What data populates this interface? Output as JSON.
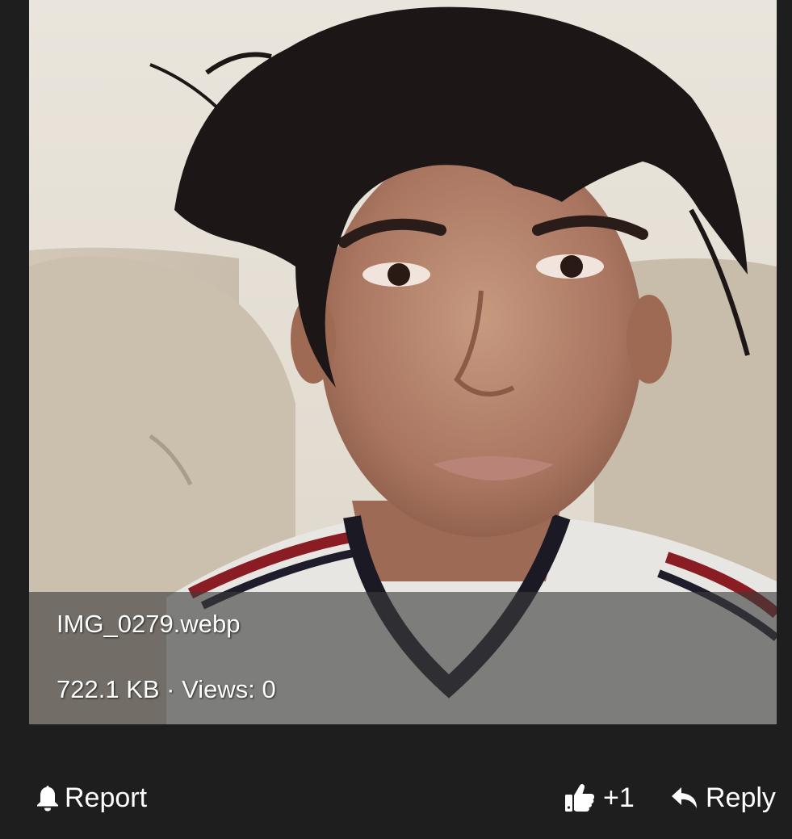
{
  "attachment": {
    "file_name": "IMG_0279.webp",
    "meta": "722.1 KB · Views: 0"
  },
  "actions": {
    "report_label": "Report",
    "like_label": "+1",
    "reply_label": "Reply",
    "report_icon": "bell-icon",
    "like_icon": "thumbs-up-icon",
    "reply_icon": "reply-arrow-icon"
  },
  "colors": {
    "background": "#1e1e1e",
    "caption_overlay": "rgba(60,60,60,0.62)",
    "text": "#ffffff"
  }
}
